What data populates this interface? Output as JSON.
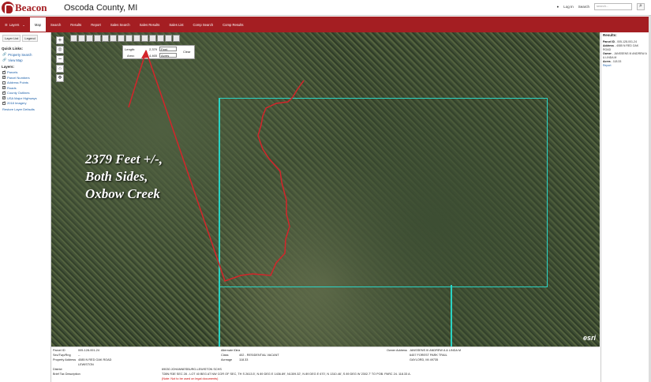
{
  "header": {
    "brand": "Beacon",
    "title": "Oscoda County, MI",
    "login": "Log In",
    "search_label": "Search",
    "search_placeholder": "search..."
  },
  "nav": {
    "layers": "Layers",
    "items": [
      "Map",
      "Search",
      "Results",
      "Report",
      "Sales Search",
      "Sales Results",
      "Sales List",
      "Comp Search",
      "Comp Results"
    ]
  },
  "left": {
    "tabs": [
      "Layer List",
      "Legend"
    ],
    "quick_links_title": "Quick Links:",
    "quick_links": [
      "Property Search",
      "View Map"
    ],
    "layers_title": "Layers:",
    "layers": [
      {
        "label": "Parcels",
        "checked": true
      },
      {
        "label": "Parcel Numbers",
        "checked": true
      },
      {
        "label": "Address Points",
        "checked": false
      },
      {
        "label": "Roads",
        "checked": true
      },
      {
        "label": "County Outlines",
        "checked": true
      },
      {
        "label": "USA Major Highways",
        "checked": true
      },
      {
        "label": "2018 Imagery",
        "checked": true
      }
    ],
    "restore": "Restore Layer Defaults"
  },
  "measure": {
    "length_label": "Length:",
    "length_value": "2,379",
    "length_unit": "Feet",
    "area_label": "Area:",
    "area_value": "4,465",
    "area_unit": "Acres",
    "clear": "Clear"
  },
  "map": {
    "annotation_lines": [
      "2379 Feet +/-,",
      "Both Sides,",
      "Oxbow Creek"
    ],
    "attribution": "esri"
  },
  "right": {
    "title": "Results:",
    "parcel_id_label": "Parcel ID",
    "parcel_id": "005-128-001-24",
    "address_label": "Address",
    "address": "4085 N RED OAK ROAD",
    "owner_label": "Owner",
    "owner": "JANSSENS III ANDREW A & LINDA M",
    "acres_label": "Acres",
    "acres": "118.33",
    "links": "Report"
  },
  "bottom": {
    "parcel_id_label": "Parcel ID",
    "parcel_id": "005-128-001-24",
    "sec_label": "Sec/Twp/Rng",
    "sec": "--",
    "prop_addr_label": "Property Address",
    "prop_addr": "4085 N RED OAK ROAD",
    "prop_city": "LEWISTON",
    "district_label": "District",
    "tax_desc_label": "Brief Tax Description",
    "alt_id_label": "Alternate ID",
    "alt_id": "n/a",
    "class_label": "Class",
    "class": "402 - RESIDENTIAL VACANT",
    "acreage_label": "Acreage",
    "acreage": "118.33",
    "school": "69030 JOHANNESBURG-LEWISTON SCHS",
    "tax_desc": "T28N R3E SEC 28 - LOT 40 BEG AT NW COR OF SEC, TH S 2613.5', N 89 DEG E 1436.89', N1309.32', N 89 DEG E 670', N 1310.46', S 89 DEG W 2302.7' TO POB. PARC 24. 118.33 A.",
    "note": "(Note: Not to be used on legal documents)",
    "owner_label": "Owner Address",
    "owner": "JANSSENS III ANDREW A & LINDA M",
    "owner_addr1": "6457 FOREST PARK TRAIL",
    "owner_addr2": "GAYLORD, MI 49735"
  }
}
